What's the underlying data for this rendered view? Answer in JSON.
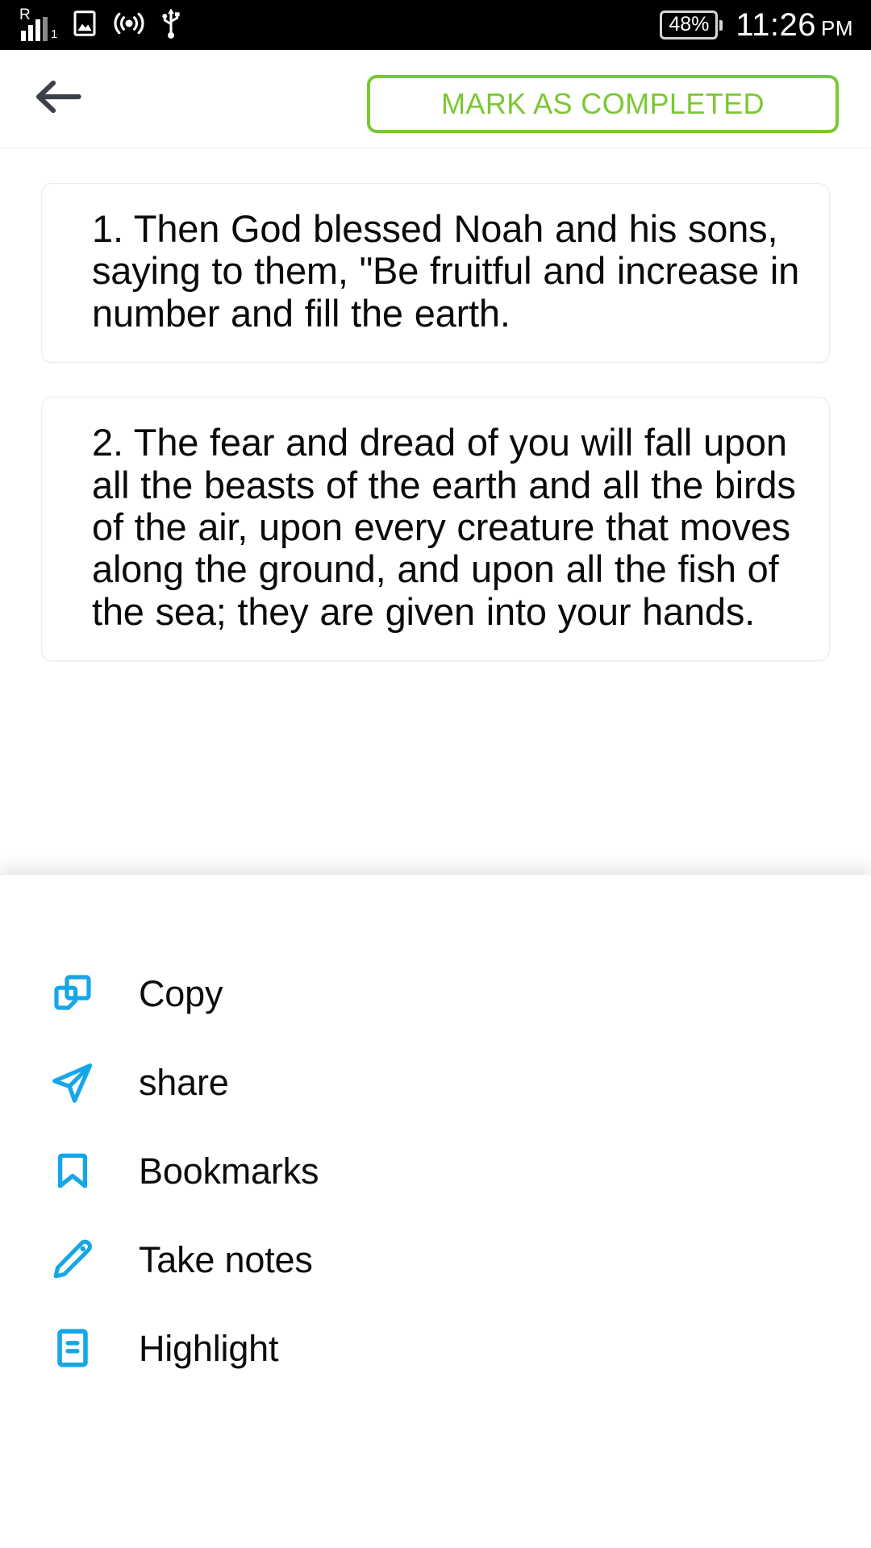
{
  "status_bar": {
    "roaming_label": "R",
    "sim_index": "1",
    "icons": [
      "signal-bars-icon",
      "gallery-image-icon",
      "hotspot-icon",
      "usb-icon"
    ],
    "battery_percent": "48%",
    "time": "11:26",
    "am_pm": "PM"
  },
  "app_bar": {
    "back_icon": "back-arrow-icon",
    "mark_completed_label": "MARK AS COMPLETED",
    "accent_green": "#7AC832"
  },
  "content": {
    "verses": [
      {
        "text": "1. Then God blessed Noah and his sons, saying to them, \"Be fruitful and increase in number and fill the earth."
      },
      {
        "text": "2. The fear and dread of you will fall upon all the beasts of the earth and all the birds of the air, upon every creature that moves along the ground, and upon all the fish of the sea; they are given into your hands."
      }
    ]
  },
  "bottom_sheet": {
    "accent_blue": "#16A6E8",
    "items": [
      {
        "icon": "copy-icon",
        "label": "Copy"
      },
      {
        "icon": "share-icon",
        "label": "share"
      },
      {
        "icon": "bookmark-icon",
        "label": "Bookmarks"
      },
      {
        "icon": "pencil-icon",
        "label": "Take notes"
      },
      {
        "icon": "highlight-icon",
        "label": "Highlight"
      }
    ]
  }
}
